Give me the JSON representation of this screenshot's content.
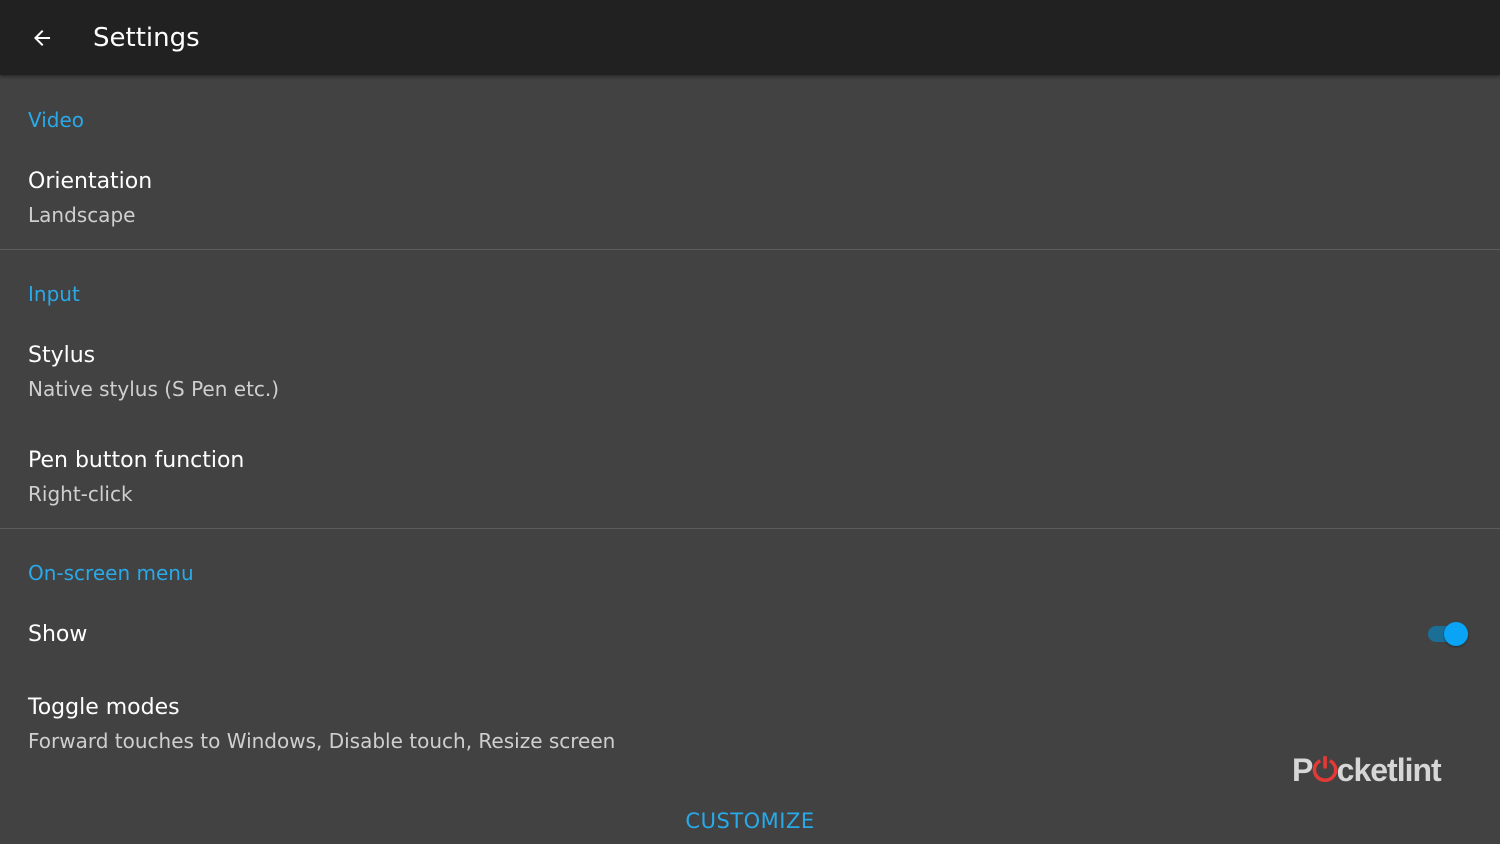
{
  "appbar": {
    "title": "Settings",
    "back_icon": "arrow-left-icon"
  },
  "sections": {
    "video": {
      "header": "Video",
      "orientation": {
        "title": "Orientation",
        "summary": "Landscape"
      }
    },
    "input": {
      "header": "Input",
      "stylus": {
        "title": "Stylus",
        "summary": "Native stylus (S Pen etc.)"
      },
      "pen_button": {
        "title": "Pen button function",
        "summary": "Right-click"
      }
    },
    "onscreen_menu": {
      "header": "On-screen menu",
      "show": {
        "title": "Show",
        "enabled": true
      },
      "toggle_modes": {
        "title": "Toggle modes",
        "summary": "Forward touches to Windows, Disable touch, Resize screen"
      },
      "customize_label": "CUSTOMIZE"
    }
  },
  "watermark": {
    "prefix": "P",
    "power_glyph": "⏻",
    "suffix": "cketlint"
  },
  "colors": {
    "appbar_bg": "#212121",
    "page_bg": "#424242",
    "accent": "#29a9e8",
    "toggle_thumb": "#0aa4f6",
    "watermark_power": "#e53935"
  }
}
